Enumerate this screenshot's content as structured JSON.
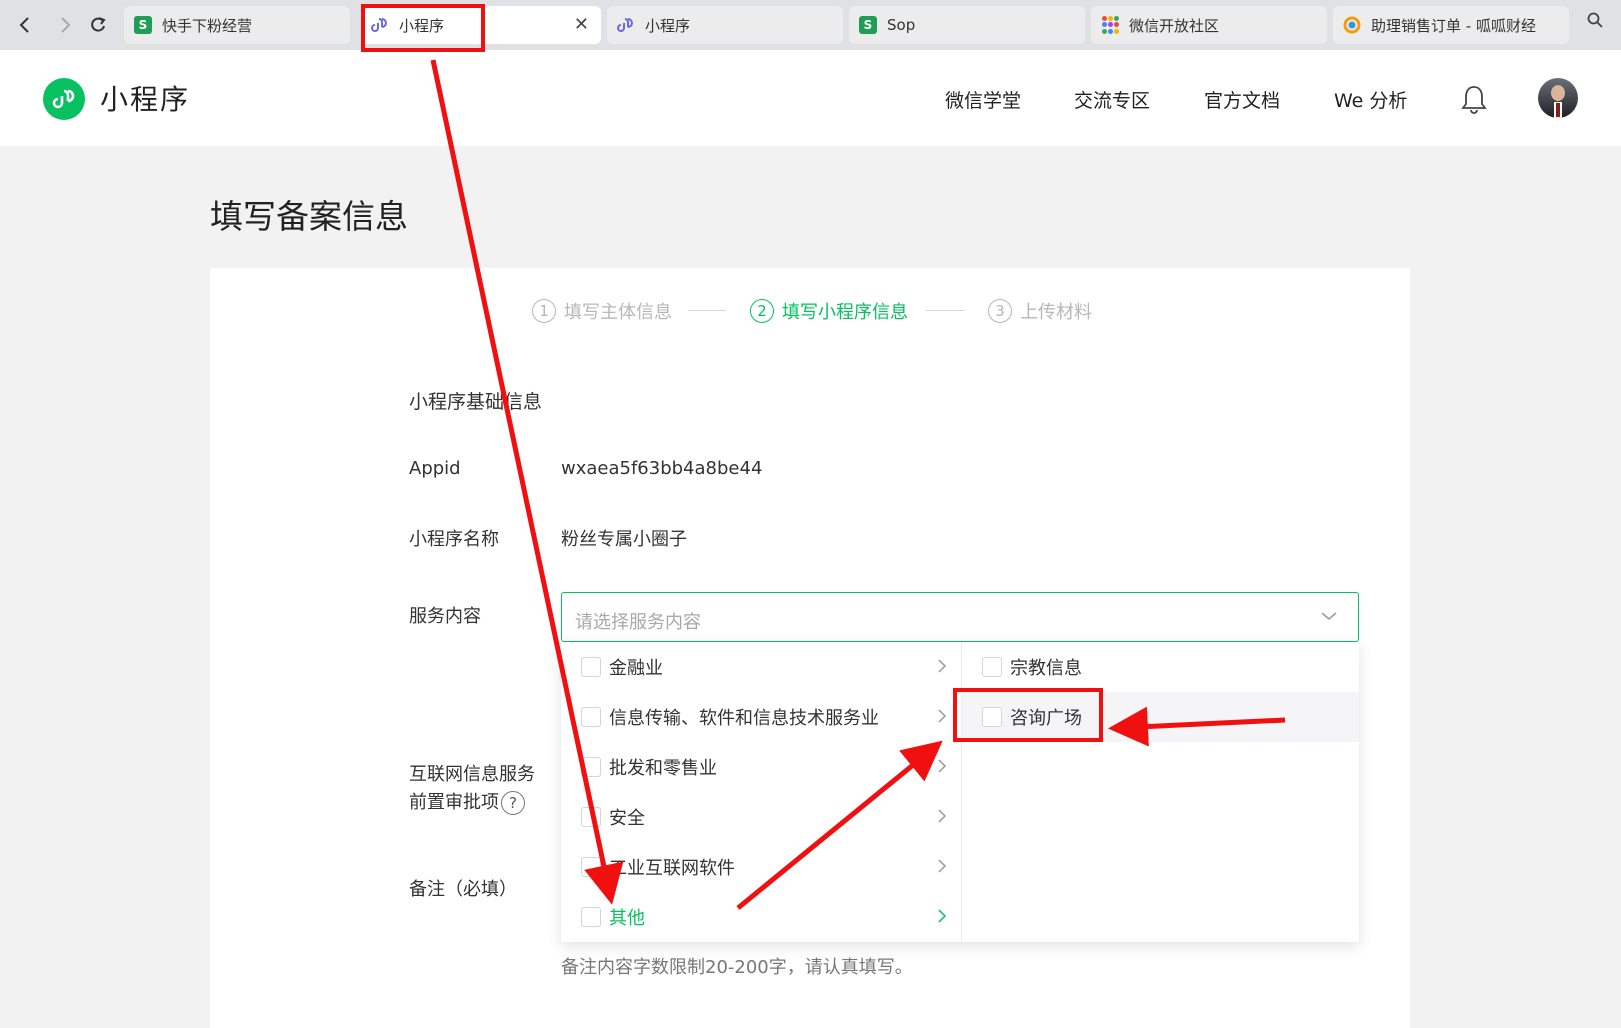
{
  "browser": {
    "tabs": [
      {
        "title": "快手下粉经营",
        "favicon": "sheet-icon"
      },
      {
        "title": "小程序",
        "favicon": "miniprogram-link-icon",
        "active": true
      },
      {
        "title": "小程序",
        "favicon": "miniprogram-link-icon"
      },
      {
        "title": "Sop",
        "favicon": "sheet-icon"
      },
      {
        "title": "微信开放社区",
        "favicon": "dots-icon"
      },
      {
        "title": "助理销售订单 - 呱呱财经",
        "favicon": "rainbow-icon"
      }
    ],
    "sheet_letter": "S",
    "close_glyph": "✕"
  },
  "header": {
    "app_title": "小程序",
    "nav": [
      "微信学堂",
      "交流专区",
      "官方文档",
      "We 分析"
    ]
  },
  "page": {
    "title": "填写备案信息",
    "steps": [
      {
        "num": "1",
        "label": "填写主体信息"
      },
      {
        "num": "2",
        "label": "填写小程序信息",
        "active": true
      },
      {
        "num": "3",
        "label": "上传材料"
      }
    ]
  },
  "form": {
    "section_title": "小程序基础信息",
    "appid_label": "Appid",
    "appid_value": "wxaea5f63bb4a8be44",
    "name_label": "小程序名称",
    "name_value": "粉丝专属小圈子",
    "service_label": "服务内容",
    "service_placeholder": "请选择服务内容",
    "approval_label_line1": "互联网信息服务",
    "approval_label_line2": "前置审批项",
    "remark_label": "备注（必填）",
    "remark_hint": "备注内容字数限制20-200字，请认真填写。"
  },
  "dropdown": {
    "level1": [
      "金融业",
      "信息传输、软件和信息技术服务业",
      "批发和零售业",
      "安全",
      "工业互联网软件",
      "其他"
    ],
    "level1_active_index": 5,
    "level2": [
      "宗教信息",
      "咨询广场"
    ],
    "level2_hover_index": 1
  },
  "colors": {
    "brand_green": "#07c160",
    "annotation_red": "#f01010"
  }
}
